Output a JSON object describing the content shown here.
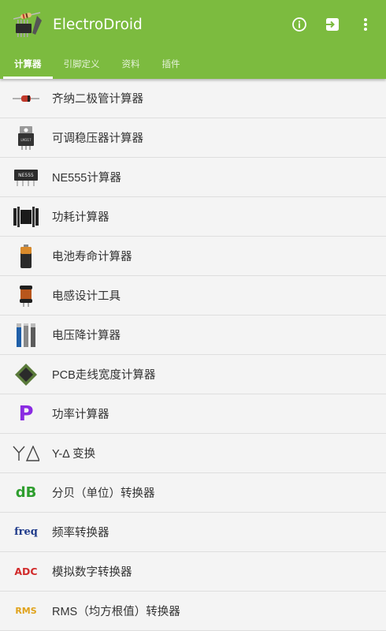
{
  "app": {
    "title": "ElectroDroid"
  },
  "toolbar": {
    "info_icon": "info-circle-icon",
    "exit_icon": "exit-app-icon",
    "more_icon": "more-vert-icon"
  },
  "tabs": [
    {
      "label": "计算器",
      "active": true
    },
    {
      "label": "引脚定义",
      "active": false
    },
    {
      "label": "资料",
      "active": false
    },
    {
      "label": "插件",
      "active": false
    }
  ],
  "items": [
    {
      "label": "齐纳二极管计算器",
      "icon": "zener-diode-icon"
    },
    {
      "label": "可调稳压器计算器",
      "icon": "voltage-regulator-icon"
    },
    {
      "label": "NE555计算器",
      "icon": "ne555-chip-icon",
      "icon_text": "NE555"
    },
    {
      "label": "功耗计算器",
      "icon": "heatsink-icon"
    },
    {
      "label": "电池寿命计算器",
      "icon": "battery-icon"
    },
    {
      "label": "电感设计工具",
      "icon": "inductor-icon"
    },
    {
      "label": "电压降计算器",
      "icon": "wires-icon"
    },
    {
      "label": "PCB走线宽度计算器",
      "icon": "pcb-chip-icon"
    },
    {
      "label": "功率计算器",
      "icon": "power-p-icon",
      "icon_text": "P"
    },
    {
      "label": "Y-Δ 变换",
      "icon": "y-delta-icon"
    },
    {
      "label": "分贝（单位）转换器",
      "icon": "decibel-icon",
      "icon_text": "dB"
    },
    {
      "label": "频率转换器",
      "icon": "frequency-icon",
      "icon_text": "freq"
    },
    {
      "label": "模拟数字转换器",
      "icon": "adc-icon",
      "icon_text": "ADC"
    },
    {
      "label": "RMS（均方根值）转换器",
      "icon": "rms-icon",
      "icon_text": "RMS"
    }
  ],
  "colors": {
    "primary": "#7cbb3f",
    "background": "#f4f4f4",
    "divider": "#dedede",
    "text": "#333333"
  }
}
